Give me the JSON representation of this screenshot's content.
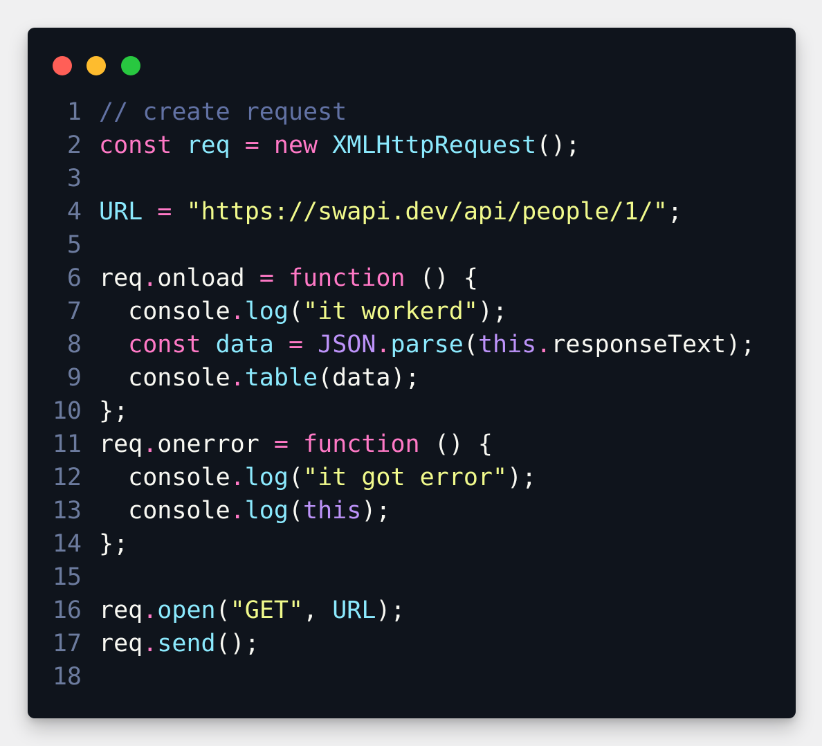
{
  "window": {
    "controls": {
      "close": "#ff5f57",
      "minimize": "#febc2e",
      "maximize": "#28c840"
    }
  },
  "theme": {
    "background": "#0f141c",
    "line_number": "#6c7b9e",
    "keyword": "#ff79c6",
    "variable": "#8be9fd",
    "string": "#f1fa8c",
    "comment": "#6272a4",
    "this": "#bd93f9",
    "plain": "#f8f8f2"
  },
  "lines": [
    {
      "num": "1",
      "tokens": [
        {
          "t": "comment",
          "v": "// create request"
        }
      ]
    },
    {
      "num": "2",
      "tokens": [
        {
          "t": "keyword",
          "v": "const"
        },
        {
          "t": "plain",
          "v": " "
        },
        {
          "t": "variable",
          "v": "req"
        },
        {
          "t": "plain",
          "v": " "
        },
        {
          "t": "operator",
          "v": "="
        },
        {
          "t": "plain",
          "v": " "
        },
        {
          "t": "keyword",
          "v": "new"
        },
        {
          "t": "plain",
          "v": " "
        },
        {
          "t": "class",
          "v": "XMLHttpRequest"
        },
        {
          "t": "punct",
          "v": "();"
        }
      ]
    },
    {
      "num": "3",
      "tokens": []
    },
    {
      "num": "4",
      "tokens": [
        {
          "t": "variable",
          "v": "URL"
        },
        {
          "t": "plain",
          "v": " "
        },
        {
          "t": "operator",
          "v": "="
        },
        {
          "t": "plain",
          "v": " "
        },
        {
          "t": "string",
          "v": "\"https://swapi.dev/api/people/1/\""
        },
        {
          "t": "punct",
          "v": ";"
        }
      ]
    },
    {
      "num": "5",
      "tokens": []
    },
    {
      "num": "6",
      "tokens": [
        {
          "t": "plain",
          "v": "req"
        },
        {
          "t": "dot",
          "v": "."
        },
        {
          "t": "plain",
          "v": "onload"
        },
        {
          "t": "plain",
          "v": " "
        },
        {
          "t": "operator",
          "v": "="
        },
        {
          "t": "plain",
          "v": " "
        },
        {
          "t": "keyword",
          "v": "function"
        },
        {
          "t": "plain",
          "v": " "
        },
        {
          "t": "punct",
          "v": "() {"
        }
      ]
    },
    {
      "num": "7",
      "tokens": [
        {
          "t": "plain",
          "v": "  console"
        },
        {
          "t": "dot",
          "v": "."
        },
        {
          "t": "method",
          "v": "log"
        },
        {
          "t": "punct",
          "v": "("
        },
        {
          "t": "string",
          "v": "\"it workerd\""
        },
        {
          "t": "punct",
          "v": ");"
        }
      ]
    },
    {
      "num": "8",
      "tokens": [
        {
          "t": "plain",
          "v": "  "
        },
        {
          "t": "keyword",
          "v": "const"
        },
        {
          "t": "plain",
          "v": " "
        },
        {
          "t": "variable",
          "v": "data"
        },
        {
          "t": "plain",
          "v": " "
        },
        {
          "t": "operator",
          "v": "="
        },
        {
          "t": "plain",
          "v": " "
        },
        {
          "t": "json",
          "v": "JSON"
        },
        {
          "t": "dot",
          "v": "."
        },
        {
          "t": "method",
          "v": "parse"
        },
        {
          "t": "punct",
          "v": "("
        },
        {
          "t": "this",
          "v": "this"
        },
        {
          "t": "dot",
          "v": "."
        },
        {
          "t": "plain",
          "v": "responseText"
        },
        {
          "t": "punct",
          "v": ");"
        }
      ]
    },
    {
      "num": "9",
      "tokens": [
        {
          "t": "plain",
          "v": "  console"
        },
        {
          "t": "dot",
          "v": "."
        },
        {
          "t": "method",
          "v": "table"
        },
        {
          "t": "punct",
          "v": "(data);"
        }
      ]
    },
    {
      "num": "10",
      "tokens": [
        {
          "t": "punct",
          "v": "};"
        }
      ]
    },
    {
      "num": "11",
      "tokens": [
        {
          "t": "plain",
          "v": "req"
        },
        {
          "t": "dot",
          "v": "."
        },
        {
          "t": "plain",
          "v": "onerror"
        },
        {
          "t": "plain",
          "v": " "
        },
        {
          "t": "operator",
          "v": "="
        },
        {
          "t": "plain",
          "v": " "
        },
        {
          "t": "keyword",
          "v": "function"
        },
        {
          "t": "plain",
          "v": " "
        },
        {
          "t": "punct",
          "v": "() {"
        }
      ]
    },
    {
      "num": "12",
      "tokens": [
        {
          "t": "plain",
          "v": "  console"
        },
        {
          "t": "dot",
          "v": "."
        },
        {
          "t": "method",
          "v": "log"
        },
        {
          "t": "punct",
          "v": "("
        },
        {
          "t": "string",
          "v": "\"it got error\""
        },
        {
          "t": "punct",
          "v": ");"
        }
      ]
    },
    {
      "num": "13",
      "tokens": [
        {
          "t": "plain",
          "v": "  console"
        },
        {
          "t": "dot",
          "v": "."
        },
        {
          "t": "method",
          "v": "log"
        },
        {
          "t": "punct",
          "v": "("
        },
        {
          "t": "this",
          "v": "this"
        },
        {
          "t": "punct",
          "v": ");"
        }
      ]
    },
    {
      "num": "14",
      "tokens": [
        {
          "t": "punct",
          "v": "};"
        }
      ]
    },
    {
      "num": "15",
      "tokens": []
    },
    {
      "num": "16",
      "tokens": [
        {
          "t": "plain",
          "v": "req"
        },
        {
          "t": "dot",
          "v": "."
        },
        {
          "t": "method",
          "v": "open"
        },
        {
          "t": "punct",
          "v": "("
        },
        {
          "t": "string",
          "v": "\"GET\""
        },
        {
          "t": "punct",
          "v": ", "
        },
        {
          "t": "variable",
          "v": "URL"
        },
        {
          "t": "punct",
          "v": ");"
        }
      ]
    },
    {
      "num": "17",
      "tokens": [
        {
          "t": "plain",
          "v": "req"
        },
        {
          "t": "dot",
          "v": "."
        },
        {
          "t": "method",
          "v": "send"
        },
        {
          "t": "punct",
          "v": "();"
        }
      ]
    },
    {
      "num": "18",
      "tokens": []
    }
  ]
}
